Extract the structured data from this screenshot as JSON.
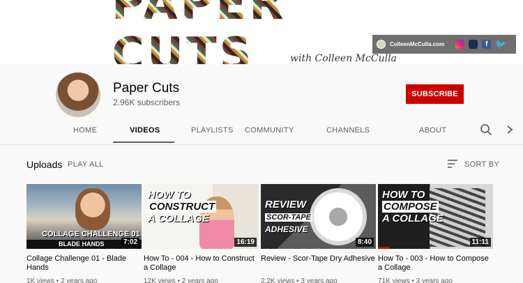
{
  "banner": {
    "title": "PAPER CUTS",
    "with_text": "with Colleen McCulla",
    "website": "ColleenMcCulla.com",
    "social_icons": [
      "instagram-icon",
      "imdb-icon",
      "facebook-icon",
      "twitter-icon"
    ]
  },
  "channel": {
    "name": "Paper Cuts",
    "subscribers": "2.96K subscribers",
    "subscribe_label": "SUBSCRIBE"
  },
  "tabs": [
    {
      "label": "HOME"
    },
    {
      "label": "VIDEOS",
      "active": true
    },
    {
      "label": "PLAYLISTS"
    },
    {
      "label": "COMMUNITY"
    },
    {
      "label": "CHANNELS"
    },
    {
      "label": "ABOUT"
    }
  ],
  "uploads": {
    "title": "Uploads",
    "play_all": "PLAY ALL",
    "sort_label": "SORT BY"
  },
  "videos": [
    {
      "title": "Collage Challenge 01 - Blade Hands",
      "duration": "7:02",
      "views": "1K views",
      "age": "2 years ago",
      "thumb_text": [
        "COLLAGE CHALLENGE 01",
        "BLADE HANDS"
      ]
    },
    {
      "title": "How To - 004 - How to Construct a Collage",
      "duration": "16:19",
      "views": "12K views",
      "age": "2 years ago",
      "thumb_text": [
        "HOW TO",
        "CONSTRUCT",
        "A COLLAGE"
      ]
    },
    {
      "title": "Review - Scor-Tape Dry Adhesive",
      "duration": "8:40",
      "views": "2.2K views",
      "age": "3 years ago",
      "thumb_text": [
        "REVIEW",
        "SCOR-TAPE",
        "ADHESIVE"
      ]
    },
    {
      "title": "How To - 003 - How to Compose a Collage",
      "duration": "11:11",
      "views": "71K views",
      "age": "3 years ago",
      "thumb_text": [
        "HOW TO",
        "COMPOSE",
        "A COLLAGE"
      ],
      "watch_progress": 0.1
    }
  ],
  "colors": {
    "subscribe_red": "#cc0000",
    "text_primary": "#030303",
    "text_secondary": "#606060",
    "background": "#f9f9f9"
  }
}
